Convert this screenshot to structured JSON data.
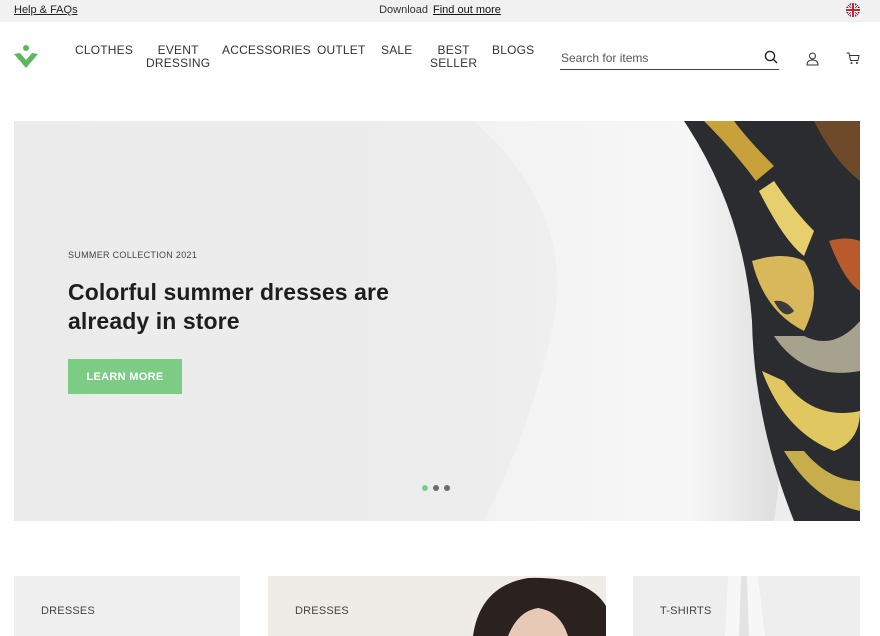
{
  "topbar": {
    "help_label": "Help & FAQs",
    "download_text": "Download",
    "download_link": "Find out more"
  },
  "header": {
    "nav": [
      {
        "line1": "CLOTHES",
        "line2": ""
      },
      {
        "line1": "EVENT",
        "line2": "DRESSING"
      },
      {
        "line1": "ACCESSORIES",
        "line2": ""
      },
      {
        "line1": "OUTLET",
        "line2": ""
      },
      {
        "line1": "SALE",
        "line2": ""
      },
      {
        "line1": "BEST",
        "line2": "SELLER"
      },
      {
        "line1": "BLOGS",
        "line2": ""
      }
    ],
    "search_placeholder": "Search for items",
    "icons": [
      "logo-icon",
      "search-icon",
      "user-icon",
      "cart-icon",
      "uk-flag-icon"
    ],
    "brand_color": "#5cb85c"
  },
  "hero": {
    "eyebrow": "SUMMER COLLECTION 2021",
    "headline": "Colorful summer dresses are already in store",
    "cta_label": "LEARN MORE",
    "cta_color": "#7dcc85",
    "slides": 3,
    "active_slide": 1
  },
  "categories": [
    {
      "label": "DRESSES"
    },
    {
      "label": "DRESSES"
    },
    {
      "label": "T-SHIRTS"
    }
  ]
}
